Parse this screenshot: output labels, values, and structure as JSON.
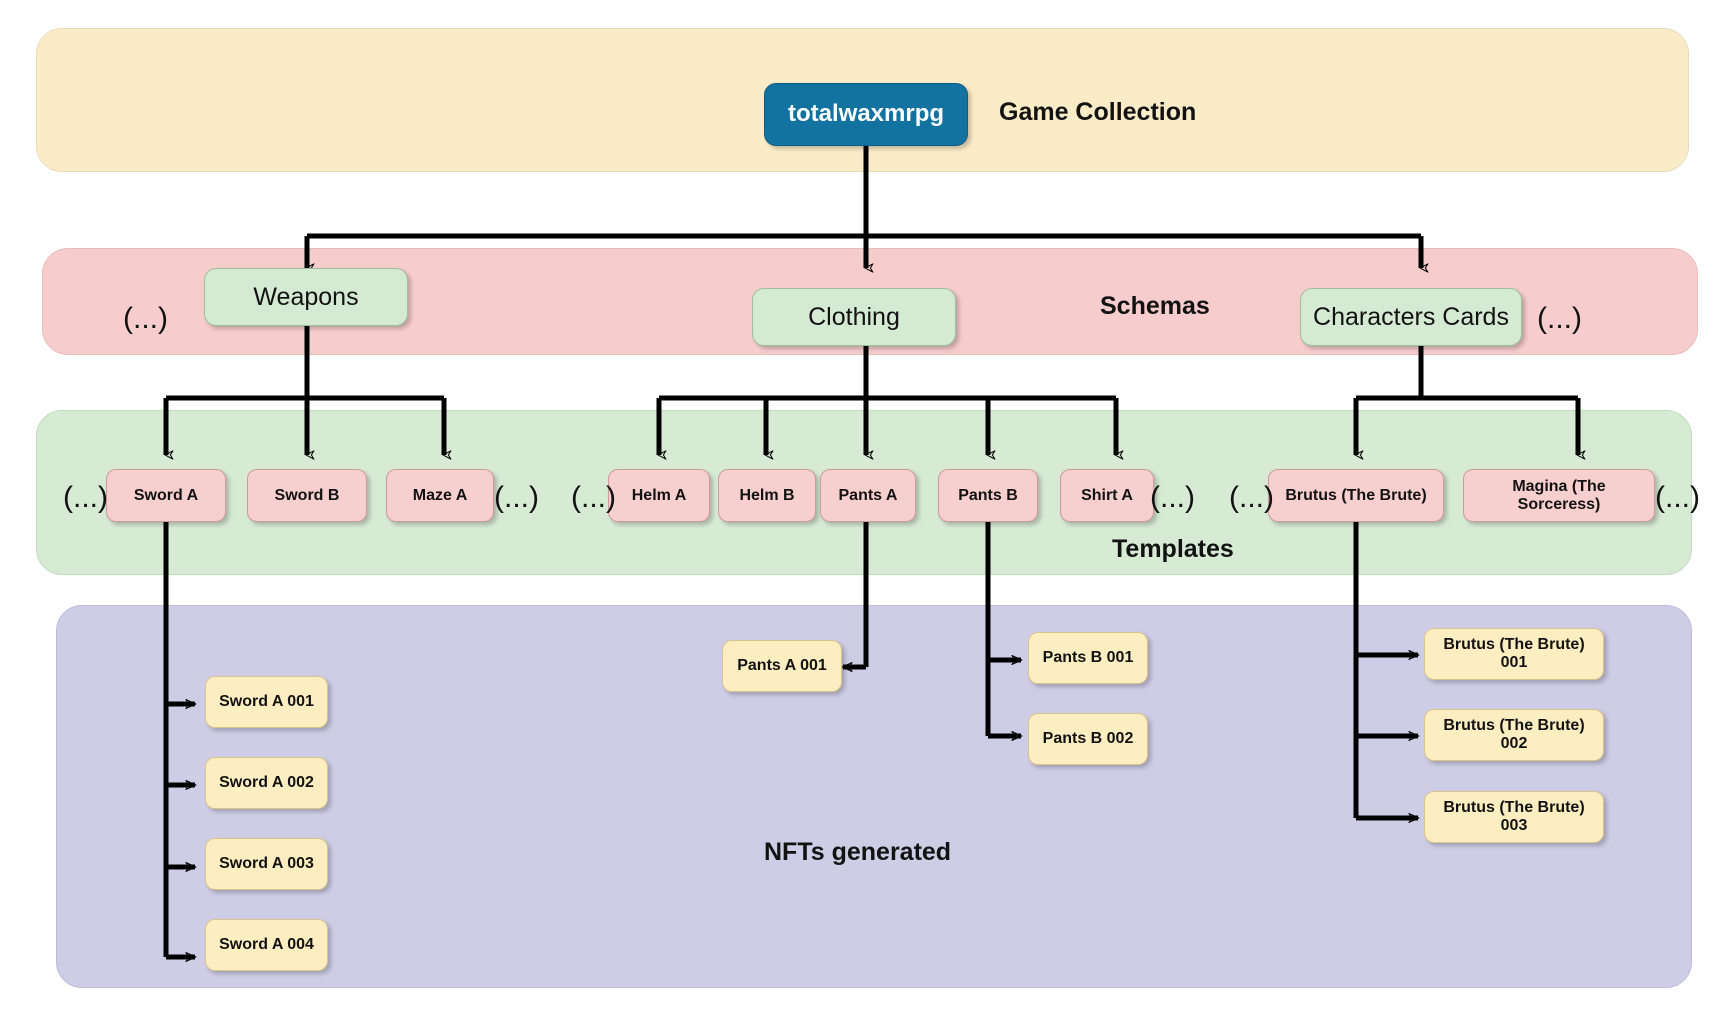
{
  "diagram": {
    "title": "NFT collection structure",
    "bands": {
      "collection": {
        "caption": "Game Collection",
        "color": "#fbecc8"
      },
      "schemas": {
        "caption": "Schemas",
        "color": "#f6cccc"
      },
      "templates": {
        "caption": "Templates",
        "color": "#d6ead4"
      },
      "nfts": {
        "caption": "NFTs generated",
        "color": "#cfcde6"
      }
    },
    "root": {
      "label": "totalwaxmrpg",
      "color": "#1272a0"
    },
    "schemas": [
      {
        "label": "Weapons"
      },
      {
        "label": "Clothing"
      },
      {
        "label": "Characters Cards"
      }
    ],
    "templates": [
      {
        "label": "Sword A"
      },
      {
        "label": "Sword B"
      },
      {
        "label": "Maze A"
      },
      {
        "label": "Helm A"
      },
      {
        "label": "Helm B"
      },
      {
        "label": "Pants A"
      },
      {
        "label": "Pants B"
      },
      {
        "label": "Shirt A"
      },
      {
        "label": "Brutus (The Brute)"
      },
      {
        "label": "Magina (The Sorceress)"
      }
    ],
    "nfts": [
      {
        "label": "Sword A 001"
      },
      {
        "label": "Sword A 002"
      },
      {
        "label": "Sword A 003"
      },
      {
        "label": "Sword A 004"
      },
      {
        "label": "Pants A 001"
      },
      {
        "label": "Pants B 001"
      },
      {
        "label": "Pants B 002"
      },
      {
        "label": "Brutus (The Brute) 001"
      },
      {
        "label": "Brutus (The Brute) 002"
      },
      {
        "label": "Brutus (The Brute) 003"
      }
    ],
    "ellipses": [
      {
        "label": "(...)",
        "row": "schemas",
        "side": "left"
      },
      {
        "label": "(...)",
        "row": "schemas",
        "side": "right"
      },
      {
        "label": "(...)",
        "row": "templates",
        "side": "weapons-left"
      },
      {
        "label": "(...)",
        "row": "templates",
        "side": "weapons-right"
      },
      {
        "label": "(...)",
        "row": "templates",
        "side": "clothing-left"
      },
      {
        "label": "(...)",
        "row": "templates",
        "side": "clothing-right"
      },
      {
        "label": "(...)",
        "row": "templates",
        "side": "characters-left"
      },
      {
        "label": "(...)",
        "row": "templates",
        "side": "characters-right"
      }
    ]
  }
}
